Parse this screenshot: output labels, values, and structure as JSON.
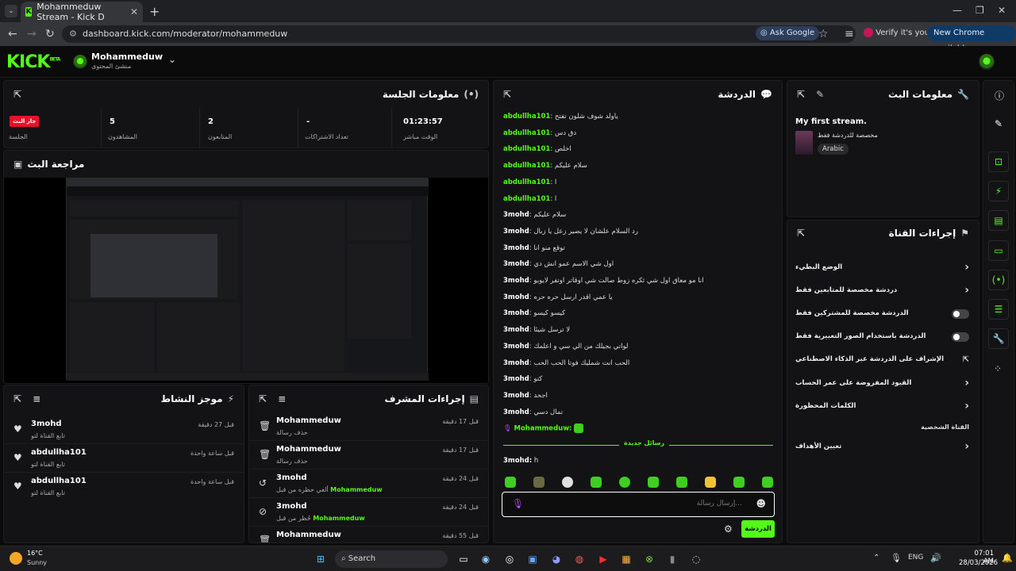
{
  "browser": {
    "tab_title": "Mohammeduw Stream - Kick D",
    "tab_close": "✕",
    "new_tab": "+",
    "url": "dashboard.kick.com/moderator/mohammeduw",
    "ask_google": "Ask Google",
    "verify": "Verify it's you",
    "new_chrome": "New Chrome available"
  },
  "header": {
    "logo": "KICK",
    "logo_sup": "BETA",
    "channel_name": "Mohammeduw",
    "channel_role": "منشئ المحتوى"
  },
  "session_info": {
    "title": "معلومات الجلسة",
    "badge": "جار البث",
    "session_label": "الجلسة",
    "viewers_value": "5",
    "viewers_label": "المشاهدون",
    "followers_value": "2",
    "followers_label": "المتابعون",
    "subs_value": "-",
    "subs_label": "تعداد الاشتراكات",
    "live_time_value": "01:23:57",
    "live_time_label": "الوقت مباشر"
  },
  "stream_preview": {
    "title": "مراجعة البث"
  },
  "activity": {
    "title": "موجز النشاط",
    "items": [
      {
        "name": "3mohd",
        "sub": "تابع القناة لتو",
        "time": "قبل 27 دقيقة"
      },
      {
        "name": "abdullha101",
        "sub": "تابع القناة لتو",
        "time": "قبل ساعة واحدة"
      },
      {
        "name": "abdullha101",
        "sub": "تابع القناة لتو",
        "time": "قبل ساعة واحدة"
      }
    ]
  },
  "mod_actions": {
    "title": "إجراءات المشرف",
    "items": [
      {
        "icon": "trash-icon",
        "name": "Mohammeduw",
        "sub": "حذف رسالة",
        "time": "قبل 17 دقيقة"
      },
      {
        "icon": "trash-icon",
        "name": "Mohammeduw",
        "sub": "حذف رسالة",
        "time": "قبل 17 دقيقة"
      },
      {
        "icon": "undo-icon",
        "name": "3mohd",
        "sub": "ألغي حظره من قبل",
        "by": "Mohammeduw",
        "time": "قبل 24 دقيقة"
      },
      {
        "icon": "ban-icon",
        "name": "3mohd",
        "sub": "حُظر من قبل",
        "by": "Mohammeduw",
        "time": "قبل 24 دقيقة"
      },
      {
        "icon": "trash-icon",
        "name": "Mohammeduw",
        "sub": "",
        "time": "قبل 55 دقيقة"
      }
    ]
  },
  "chat": {
    "title": "الدردشة",
    "messages": [
      {
        "user": "abdullha101",
        "color": "green",
        "text": "ياولد شوف شلون تفتح"
      },
      {
        "user": "abdullha101",
        "color": "green",
        "text": "دق دس"
      },
      {
        "user": "abdullha101",
        "color": "green",
        "text": "اخلص"
      },
      {
        "user": "abdullha101",
        "color": "green",
        "text": "سلام عليكم"
      },
      {
        "user": "abdullha101",
        "color": "green",
        "text": "ا"
      },
      {
        "user": "abdullha101",
        "color": "green",
        "text": "ا"
      },
      {
        "user": "3mohd",
        "color": "white",
        "text": "سلام عليكم"
      },
      {
        "user": "3mohd",
        "color": "white",
        "text": "رد السلام علشان لا يصير زعل يا زبال"
      },
      {
        "user": "3mohd",
        "color": "white",
        "text": "توقع منو انا"
      },
      {
        "user": "3mohd",
        "color": "white",
        "text": "اول شي الاسم عمو انش دي"
      },
      {
        "user": "3mohd",
        "color": "white",
        "text": "انا مو معاق اول شي ثكره زوط صالت شي اوقاتر اوتفر لايوبو"
      },
      {
        "user": "3mohd",
        "color": "white",
        "text": "يا عمي اقدر ارسل حره حره"
      },
      {
        "user": "3mohd",
        "color": "white",
        "text": "كيسو كيسو"
      },
      {
        "user": "3mohd",
        "color": "white",
        "text": "لا ترسل شيئا"
      },
      {
        "user": "3mohd",
        "color": "white",
        "text": "لواتي بجيلك من الي سي و اعلمك"
      },
      {
        "user": "3mohd",
        "color": "white",
        "text": "الحب انت شمليك فوتا الحب الحب"
      },
      {
        "user": "3mohd",
        "color": "white",
        "text": "كتو"
      },
      {
        "user": "3mohd",
        "color": "white",
        "text": "اجحد"
      },
      {
        "user": "3mohd",
        "color": "white",
        "text": "تمال دسي"
      }
    ],
    "self_user": "Mohammeduw:",
    "new_messages": "رسائل جديدة",
    "last_message_user": "3mohd:",
    "last_message_text": "h",
    "input_placeholder": "إرسال رسالة...",
    "send_label": "الدردشة"
  },
  "stream_info": {
    "title": "معلومات البث",
    "stream_title": "My first stream.",
    "category": "مخصصة للدردشة فقط",
    "language": "Arabic"
  },
  "channel_actions": {
    "title": "إجراءات القناة",
    "rows": [
      {
        "label": "الوضع البطيء",
        "type": "chevron"
      },
      {
        "label": "دردشة مخصصة للمتابعين فقط",
        "type": "chevron"
      },
      {
        "label": "الدردشة مخصصة للمشتركين فقط",
        "type": "toggle"
      },
      {
        "label": "الدردشة باستخدام الصور التعبيرية فقط",
        "type": "toggle"
      },
      {
        "label": "الإشراف على الدردشة عبر الذكاء الاصطناعي",
        "type": "external"
      },
      {
        "label": "القيود المفروضة على عمر الحساب",
        "type": "chevron"
      },
      {
        "label": "الكلمات المحظورة",
        "type": "chevron"
      }
    ],
    "section_label": "القناة الشخصية",
    "assign_label": "تعيين الأهداف"
  },
  "taskbar": {
    "weather_temp": "16°C",
    "weather_desc": "Sunny",
    "search": "Search",
    "lang": "ENG",
    "time": "07:01 AM",
    "date": "28/03/2026"
  },
  "colors": {
    "accent": "#53fc18",
    "panel": "#131315",
    "live_badge": "#e8112d"
  }
}
